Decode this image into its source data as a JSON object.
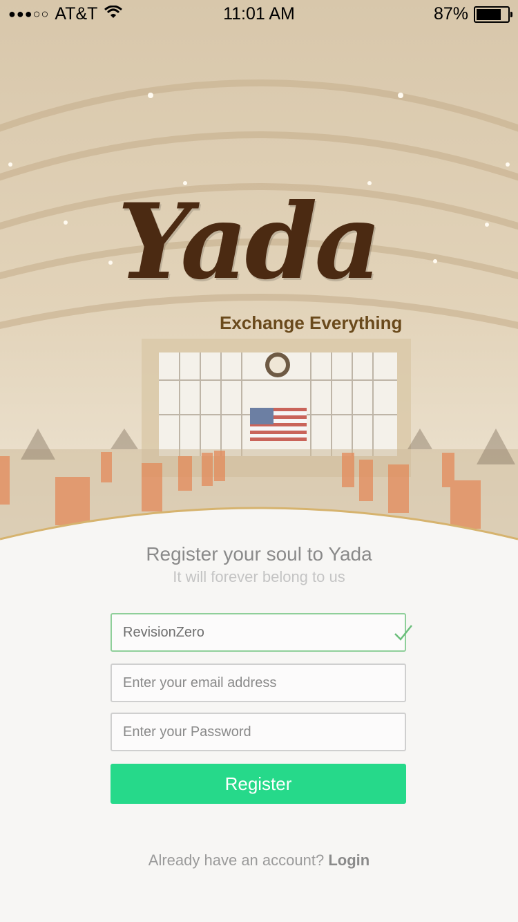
{
  "status_bar": {
    "signal": "●●●○○",
    "carrier": "AT&T",
    "time": "11:01 AM",
    "battery_percent_label": "87%",
    "battery_level": 0.87
  },
  "brand": {
    "name": "Yada",
    "tagline": "Exchange Everything"
  },
  "register": {
    "title": "Register your soul to Yada",
    "subtitle": "It will forever belong to us",
    "username": {
      "value": "RevisionZero",
      "valid": true
    },
    "email": {
      "value": "",
      "placeholder": "Enter your email address"
    },
    "password": {
      "value": "",
      "placeholder": "Enter your Password"
    },
    "submit_label": "Register"
  },
  "footer": {
    "prompt": "Already have an account?",
    "login_label": "Login"
  },
  "colors": {
    "accent_green": "#26d98a",
    "valid_border": "#8fcf9a",
    "brand_brown": "#4b2a12"
  },
  "icons": [
    "wifi-icon",
    "battery-icon",
    "checkmark-icon"
  ]
}
